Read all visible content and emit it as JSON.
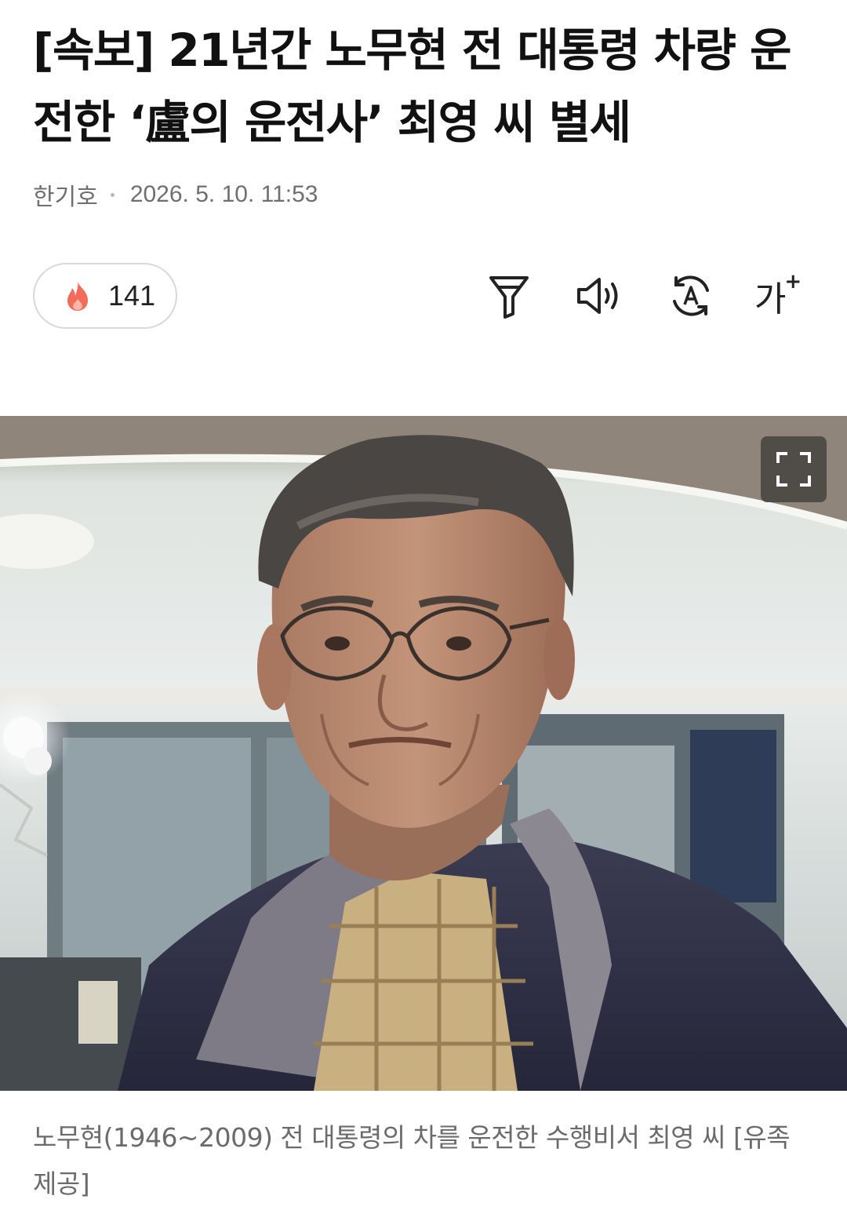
{
  "article": {
    "headline": "[속보] 21년간 노무현 전 대통령 차량 운전한 ‘盧의 운전사’ 최영 씨 별세",
    "author": "한기호",
    "datetime": "2026. 5. 10. 11:53",
    "reaction": {
      "icon": "fire-icon",
      "count": "141"
    },
    "tools": {
      "filter": "filter-icon",
      "audio": "speaker-icon",
      "translate": "translate-icon",
      "font_size": "가",
      "font_size_plus": "+"
    },
    "photo": {
      "subject": "photo of an older man with glasses wearing a navy jacket over a plaid shirt",
      "expand_icon": "expand-icon"
    },
    "caption": "노무현(1946~2009) 전 대통령의 차를 운전한 수행비서 최영 씨 [유족 제공]"
  },
  "colors": {
    "text": "#111111",
    "meta": "#6f6f6f",
    "fire": "#f26b5b",
    "border": "#d9d9d9"
  }
}
